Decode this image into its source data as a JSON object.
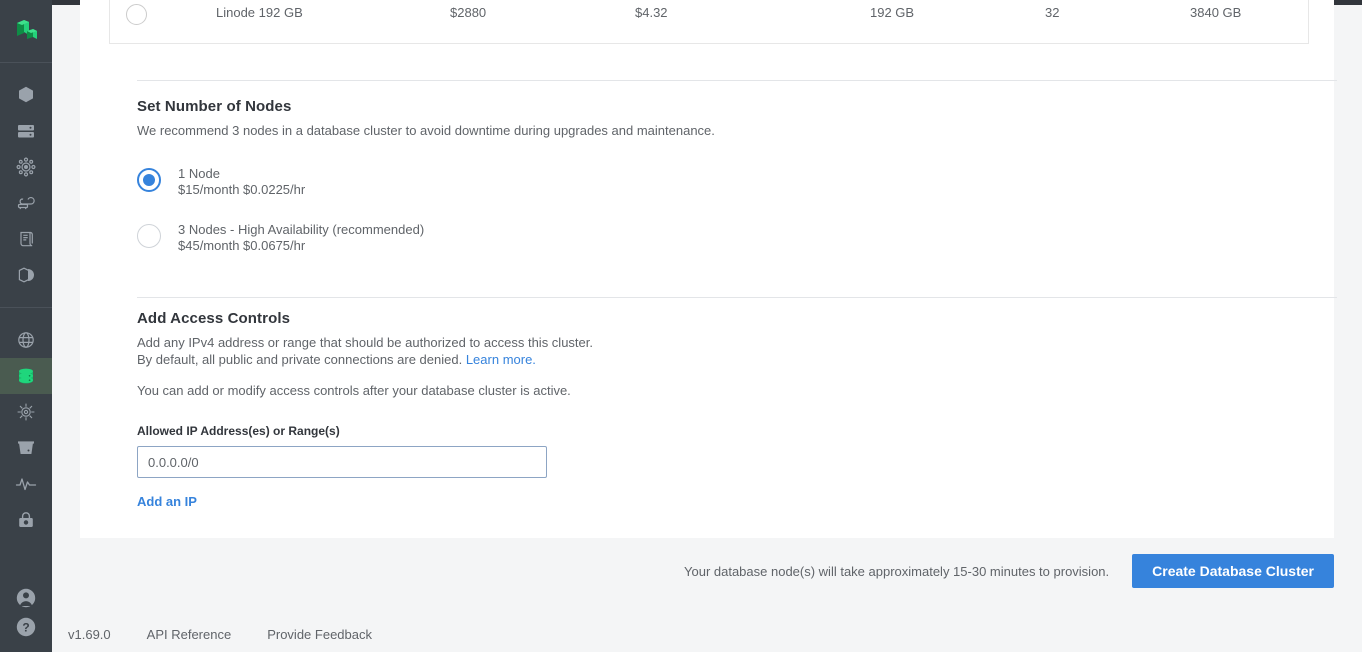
{
  "sidebar": {
    "logo": "linode-logo",
    "groups": [
      [
        {
          "icon": "hexagon-linodes-icon",
          "name": "sidebar-item-linodes",
          "active": false
        },
        {
          "icon": "volumes-icon",
          "name": "sidebar-item-volumes",
          "active": false
        },
        {
          "icon": "object-storage-icon",
          "name": "sidebar-item-object-storage",
          "active": false
        },
        {
          "icon": "nodebalancers-icon",
          "name": "sidebar-item-nodebalancers",
          "active": false
        },
        {
          "icon": "stackscripts-icon",
          "name": "sidebar-item-stackscripts",
          "active": false
        },
        {
          "icon": "images-icon",
          "name": "sidebar-item-images",
          "active": false
        }
      ],
      [
        {
          "icon": "globe-domains-icon",
          "name": "sidebar-item-domains",
          "active": false
        },
        {
          "icon": "database-icon",
          "name": "sidebar-item-databases",
          "active": true
        },
        {
          "icon": "kubernetes-icon",
          "name": "sidebar-item-kubernetes",
          "active": false
        },
        {
          "icon": "longview-bucket-icon",
          "name": "sidebar-item-longview",
          "active": false
        },
        {
          "icon": "activity-pulse-icon",
          "name": "sidebar-item-monitor",
          "active": false
        },
        {
          "icon": "marketplace-icon",
          "name": "sidebar-item-marketplace",
          "active": false
        }
      ]
    ],
    "bottom": [
      {
        "icon": "account-user-icon",
        "name": "sidebar-item-account"
      },
      {
        "icon": "help-question-icon",
        "name": "sidebar-item-help"
      }
    ]
  },
  "plan_row": {
    "radio_selected": false,
    "name": "Linode 192 GB",
    "monthly": "$2880",
    "hourly": "$4.32",
    "ram": "192 GB",
    "cpus": "32",
    "storage": "3840 GB"
  },
  "nodes": {
    "title": "Set Number of Nodes",
    "description": "We recommend 3 nodes in a database cluster to avoid downtime during upgrades and maintenance.",
    "options": [
      {
        "selected": true,
        "label": "1 Node",
        "price": "$15/month $0.0225/hr"
      },
      {
        "selected": false,
        "label": "3 Nodes - High Availability (recommended)",
        "price": "$45/month $0.0675/hr"
      }
    ]
  },
  "access": {
    "title": "Add Access Controls",
    "description_line1": "Add any IPv4 address or range that should be authorized to access this cluster.",
    "description_line2_prefix": "By default, all public and private connections are denied. ",
    "learn_more": "Learn more.",
    "note": "You can add or modify access controls after your database cluster is active.",
    "field_label": "Allowed IP Address(es) or Range(s)",
    "ip_value": "",
    "ip_placeholder": "0.0.0.0/0",
    "add_ip_label": "Add an IP"
  },
  "summary": {
    "note": "Your database node(s) will take approximately 15-30 minutes to provision.",
    "create_label": "Create Database Cluster"
  },
  "footer": {
    "links": [
      {
        "label": "v1.69.0",
        "name": "footer-version-link"
      },
      {
        "label": "API Reference",
        "name": "footer-api-reference-link"
      },
      {
        "label": "Provide Feedback",
        "name": "footer-provide-feedback-link"
      }
    ]
  },
  "colors": {
    "accent_blue": "#3683dc",
    "brand_green": "#17cf73",
    "sidebar_bg": "#3a4148",
    "page_bg": "#f4f5f6",
    "text": "#606469",
    "heading": "#32363c"
  }
}
